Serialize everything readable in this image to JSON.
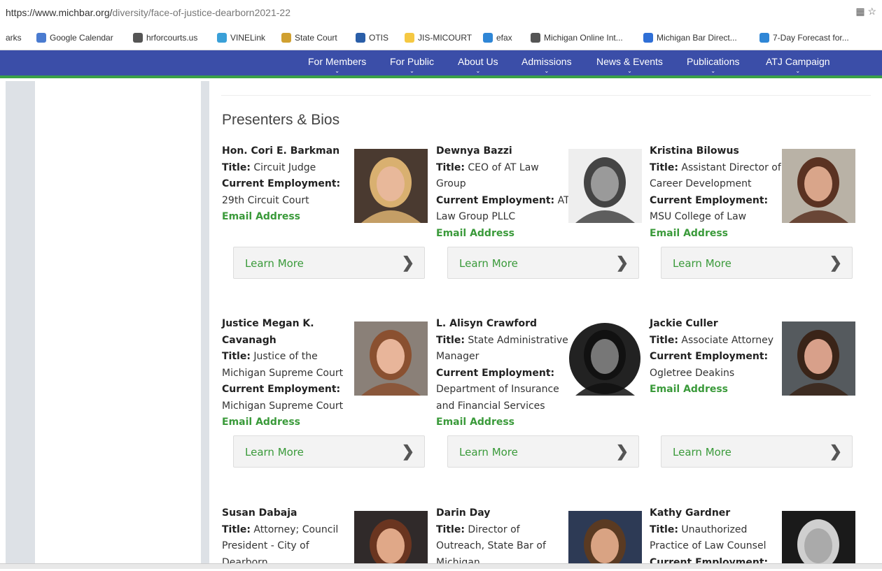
{
  "browser": {
    "url_main": "https://www.michbar.org/",
    "url_rest": "diversity/face-of-justice-dearborn2021-22"
  },
  "bookmarks": [
    {
      "label": "arks",
      "icon": "",
      "color": ""
    },
    {
      "label": "Google Calendar",
      "icon": "calendar-icon",
      "color": "#4a7bd0"
    },
    {
      "label": "hrforcourts.us",
      "icon": "globe-icon",
      "color": "#555555"
    },
    {
      "label": "VINELink",
      "icon": "vine-icon",
      "color": "#3aa0d8"
    },
    {
      "label": "State Court",
      "icon": "court-icon",
      "color": "#d0a030"
    },
    {
      "label": "OTIS",
      "icon": "otis-icon",
      "color": "#2a5ea8"
    },
    {
      "label": "JIS-MICOURT",
      "icon": "folder-icon",
      "color": "#f5c842"
    },
    {
      "label": "efax",
      "icon": "efax-icon",
      "color": "#2f86d6"
    },
    {
      "label": "Michigan Online Int...",
      "icon": "globe-icon",
      "color": "#555555"
    },
    {
      "label": "Michigan Bar Direct...",
      "icon": "zbi-icon",
      "color": "#2f6fd6"
    },
    {
      "label": "7-Day Forecast for...",
      "icon": "weather-icon",
      "color": "#2f86d6"
    }
  ],
  "nav": [
    "For Members",
    "For Public",
    "About Us",
    "Admissions",
    "News & Events",
    "Publications",
    "ATJ Campaign"
  ],
  "heading": "Presenters & Bios",
  "labels": {
    "title": "Title:",
    "employment": "Current Employment:",
    "email": "Email Address",
    "learn_more": "Learn More"
  },
  "presenters": [
    {
      "name": "Hon. Cori E. Barkman",
      "title": "Circuit Judge",
      "employment": "29th Circuit Court",
      "photo_bg": "#4a3a30",
      "face": "#e8b89a",
      "hair": "#d9b070"
    },
    {
      "name": "Dewnya Bazzi",
      "title": "CEO of AT Law Group",
      "employment": "AT Law Group PLLC",
      "photo_bg": "#eeeeee",
      "face": "#9a9a9a",
      "hair": "#444444"
    },
    {
      "name": "Kristina Bilowus",
      "title": "Assistant Director of Career Development",
      "employment": "MSU College of Law",
      "photo_bg": "#b9b2a6",
      "face": "#d9a58a",
      "hair": "#5a3222"
    },
    {
      "name": "Justice Megan K. Cavanagh",
      "title": "Justice of the Michigan Supreme Court",
      "employment": "Michigan Supreme Court",
      "photo_bg": "#8a8078",
      "face": "#e8b59a",
      "hair": "#8a5030"
    },
    {
      "name": "L. Alisyn Crawford",
      "title": "State Administrative Manager",
      "employment": "Department of Insurance and Financial Services",
      "photo_bg": "#222222",
      "face": "#777777",
      "hair": "#111111"
    },
    {
      "name": "Jackie Culler",
      "title": "Associate Attorney",
      "employment": "Ogletree Deakins",
      "photo_bg": "#555a5e",
      "face": "#d8a08a",
      "hair": "#3a2418"
    },
    {
      "name": "Susan Dabaja",
      "title": "Attorney; Council President - City of Dearborn",
      "employment": "",
      "photo_bg": "#302a2a",
      "face": "#e0a888",
      "hair": "#6a3520"
    },
    {
      "name": "Darin Day",
      "title": "Director of Outreach, State Bar of Michigan",
      "employment": "",
      "photo_bg": "#2d3a55",
      "face": "#d9a383",
      "hair": "#5a3a22"
    },
    {
      "name": "Kathy Gardner",
      "title": "Unauthorized Practice of Law Counsel",
      "employment": "",
      "photo_bg": "#1a1a1a",
      "face": "#aaaaaa",
      "hair": "#cfcfcf"
    }
  ]
}
